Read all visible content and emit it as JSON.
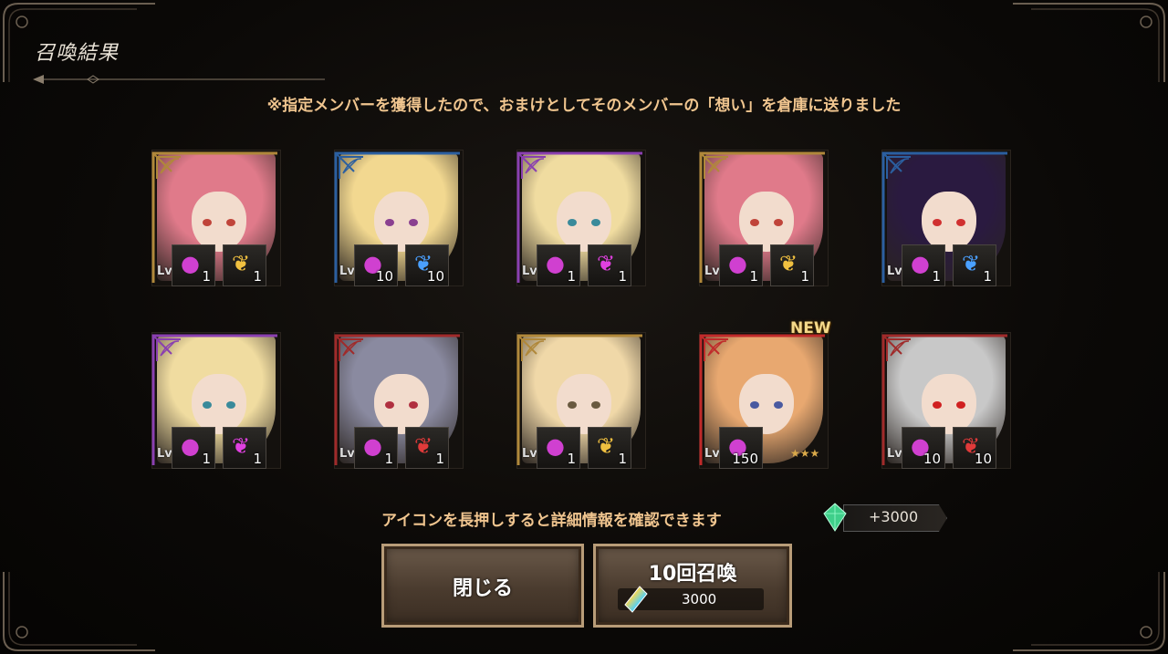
{
  "title": "召喚結果",
  "notice": "※指定メンバーを獲得したので、おまけとしてそのメンバーの「想い」を倉庫に送りました",
  "hint": "アイコンを長押しすると詳細情報を確認できます",
  "gems": "+3000",
  "close_label": "閉じる",
  "summon": {
    "label": "10回召喚",
    "cost": "3000"
  },
  "cards": [
    {
      "lv": "Lv",
      "stars": "★",
      "item1": "1",
      "item2": "1",
      "frame": "#b0883a",
      "hair": "#e07a8a",
      "eye": "#c0443a",
      "item2_color": "#f0c040",
      "new": ""
    },
    {
      "lv": "Lv",
      "stars": "★",
      "item1": "10",
      "item2": "10",
      "frame": "#2b5fa0",
      "hair": "#f2d890",
      "eye": "#8a4090",
      "item2_color": "#4aa0ff",
      "new": ""
    },
    {
      "lv": "Lv",
      "stars": "★",
      "item1": "1",
      "item2": "1",
      "frame": "#8a3fb0",
      "hair": "#f0dca0",
      "eye": "#3a8a9a",
      "item2_color": "#e040e0",
      "new": ""
    },
    {
      "lv": "Lv",
      "stars": "★",
      "item1": "1",
      "item2": "1",
      "frame": "#b0883a",
      "hair": "#e07a8a",
      "eye": "#c0443a",
      "item2_color": "#f0c040",
      "new": ""
    },
    {
      "lv": "Lv",
      "stars": "★",
      "item1": "1",
      "item2": "1",
      "frame": "#2b5fa0",
      "hair": "#2a1a40",
      "eye": "#d03030",
      "item2_color": "#4aa0ff",
      "new": ""
    },
    {
      "lv": "Lv",
      "stars": "★",
      "item1": "1",
      "item2": "1",
      "frame": "#8a3fb0",
      "hair": "#f0dca0",
      "eye": "#3a8a9a",
      "item2_color": "#e040e0",
      "new": ""
    },
    {
      "lv": "Lv",
      "stars": "★",
      "item1": "1",
      "item2": "1",
      "frame": "#a02a2a",
      "hair": "#8a8aa0",
      "eye": "#b03040",
      "item2_color": "#e03a3a",
      "new": ""
    },
    {
      "lv": "Lv",
      "stars": "★",
      "item1": "1",
      "item2": "1",
      "frame": "#b0883a",
      "hair": "#f0d8a8",
      "eye": "#6a5a40",
      "item2_color": "#f0c040",
      "new": ""
    },
    {
      "lv": "Lv.1",
      "stars": "★★★",
      "item1": "150",
      "item2": "",
      "frame": "#c02a2a",
      "hair": "#e8a870",
      "eye": "#4a5aa0",
      "item2_color": "",
      "new": "NEW"
    },
    {
      "lv": "Lv",
      "stars": "★",
      "item1": "10",
      "item2": "10",
      "frame": "#a02a2a",
      "hair": "#c8c8c8",
      "eye": "#d02020",
      "item2_color": "#e03a3a",
      "new": ""
    }
  ],
  "colors": {
    "accent_text": "#f0c58f",
    "frame_gold": "#b89c78"
  }
}
